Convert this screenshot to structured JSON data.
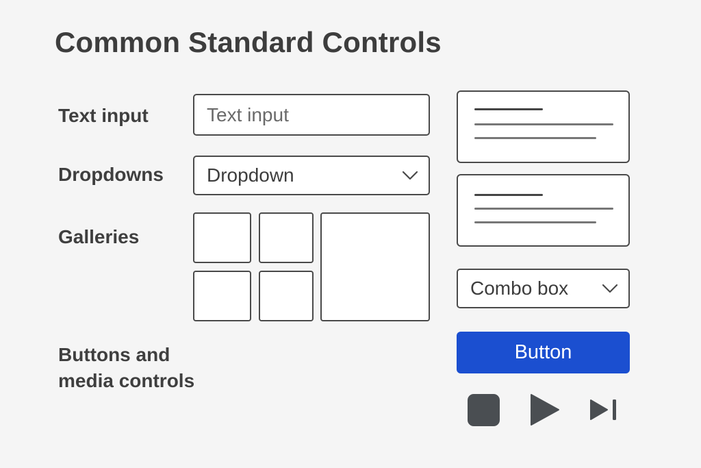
{
  "page": {
    "title": "Common Standard Controls"
  },
  "labels": {
    "text_input": "Text input",
    "dropdowns": "Dropdowns",
    "galleries": "Galleries",
    "buttons_line1": "Buttons and",
    "buttons_line2": "media controls"
  },
  "controls": {
    "text_input_placeholder": "Text input",
    "dropdown_value": "Dropdown",
    "combo_box_value": "Combo box",
    "button_label": "Button"
  },
  "media": {
    "icons": [
      "stop-icon",
      "play-icon",
      "skip-next-icon"
    ]
  },
  "colors": {
    "background": "#f5f5f5",
    "accent": "#1b4fd0",
    "border": "#4a4a4a",
    "text": "#3d3d3d",
    "media_icon": "#4a4e52"
  }
}
